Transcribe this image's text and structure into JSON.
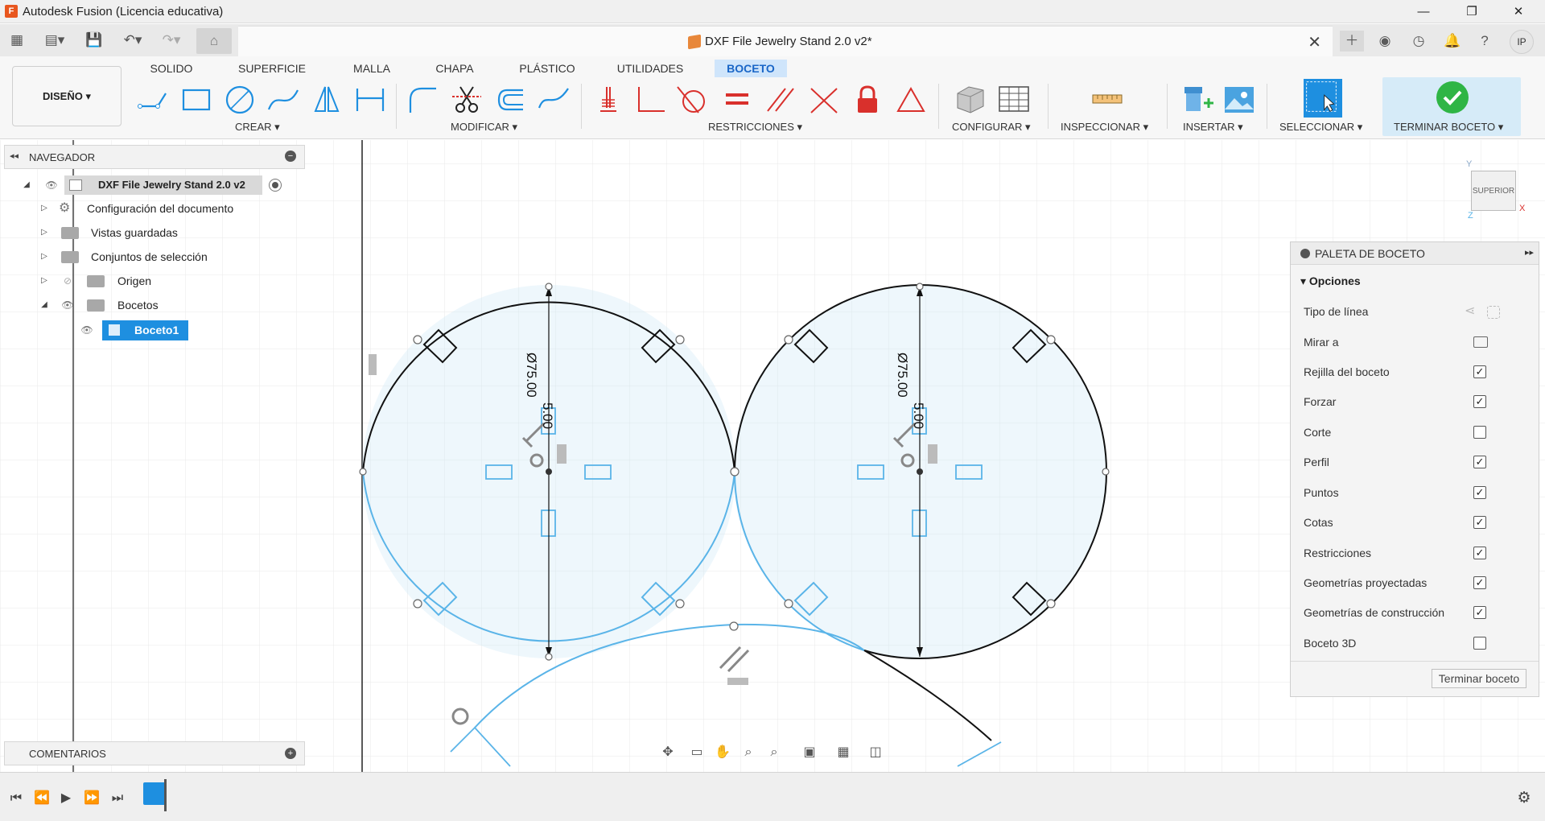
{
  "app": {
    "title": "Autodesk Fusion (Licencia educativa)",
    "logo_letter": "F"
  },
  "window": {
    "minimize": "—",
    "maximize": "❐",
    "close": "✕"
  },
  "document_tab": {
    "title": "DXF File Jewelry Stand 2.0 v2*",
    "close": "✕"
  },
  "user": {
    "initials": "IP"
  },
  "workspace": {
    "label": "DISEÑO ▾"
  },
  "ribbon_tabs": [
    {
      "label": "SOLIDO"
    },
    {
      "label": "SUPERFICIE"
    },
    {
      "label": "MALLA"
    },
    {
      "label": "CHAPA"
    },
    {
      "label": "PLÁSTICO"
    },
    {
      "label": "UTILIDADES"
    },
    {
      "label": "BOCETO"
    }
  ],
  "groups": {
    "crear": "CREAR ▾",
    "modificar": "MODIFICAR ▾",
    "restricciones": "RESTRICCIONES ▾",
    "configurar": "CONFIGURAR ▾",
    "inspeccionar": "INSPECCIONAR ▾",
    "insertar": "INSERTAR ▾",
    "seleccionar": "SELECCIONAR ▾",
    "terminar": "TERMINAR BOCETO ▾"
  },
  "browser": {
    "title": "NAVEGADOR",
    "root": "DXF File Jewelry Stand 2.0 v2",
    "items": [
      {
        "label": "Configuración del documento"
      },
      {
        "label": "Vistas guardadas"
      },
      {
        "label": "Conjuntos de selección"
      },
      {
        "label": "Origen"
      },
      {
        "label": "Bocetos"
      }
    ],
    "active_sketch": "Boceto1"
  },
  "comments": {
    "title": "COMENTARIOS"
  },
  "dimensions": {
    "d1": "Ø75.00",
    "d1b": "5.00",
    "d2": "Ø75.00",
    "d2b": "5.00"
  },
  "viewcube": {
    "face": "SUPERIOR",
    "axis_y": "Y",
    "axis_x": "X",
    "axis_z": "Z"
  },
  "palette": {
    "title": "PALETA DE BOCETO",
    "section": "Opciones",
    "rows": [
      {
        "label": "Tipo de línea"
      },
      {
        "label": "Mirar a"
      },
      {
        "label": "Rejilla del boceto",
        "checked": true
      },
      {
        "label": "Forzar",
        "checked": true
      },
      {
        "label": "Corte",
        "checked": false
      },
      {
        "label": "Perfil",
        "checked": true
      },
      {
        "label": "Puntos",
        "checked": true
      },
      {
        "label": "Cotas",
        "checked": true
      },
      {
        "label": "Restricciones",
        "checked": true
      },
      {
        "label": "Geometrías proyectadas",
        "checked": true
      },
      {
        "label": "Geometrías de construcción",
        "checked": true
      },
      {
        "label": "Boceto 3D",
        "checked": false
      }
    ],
    "finish_button": "Terminar boceto"
  },
  "colors": {
    "accent": "#1e8fe0",
    "sketch_blue": "#5ab4e8",
    "constraint_red": "#d9302c",
    "finish_green": "#2fb545"
  }
}
